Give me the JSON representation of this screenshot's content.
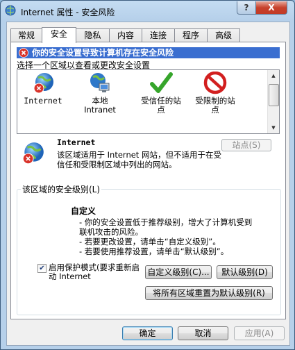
{
  "window": {
    "title": "Internet 属性 - 安全风险",
    "help_label": "?",
    "close_label": "X"
  },
  "tabs": [
    {
      "label": "常规"
    },
    {
      "label": "安全"
    },
    {
      "label": "隐私"
    },
    {
      "label": "内容"
    },
    {
      "label": "连接"
    },
    {
      "label": "程序"
    },
    {
      "label": "高级"
    }
  ],
  "warning": {
    "text": "你的安全设置导致计算机存在安全风险"
  },
  "zone_prompt": "选择一个区域以查看或更改安全设置",
  "zones": [
    {
      "label": "Internet",
      "icon": "globe-error-icon"
    },
    {
      "label": "本地\nIntranet",
      "icon": "intranet-icon"
    },
    {
      "label": "受信任的站\n点",
      "icon": "green-check-icon"
    },
    {
      "label": "受限制的站\n点",
      "icon": "restricted-icon"
    }
  ],
  "zone_info": {
    "title": "Internet",
    "description": "该区域适用于 Internet 网站，但不适用于在受信任和受限制区域中列出的网站。",
    "sites_button": "站点(S)"
  },
  "security_level": {
    "group_label": "该区域的安全级别(L)",
    "level_name": "自定义",
    "description": "- 你的安全设置低于推荐级别，增大了计算机受到联机攻击的风险。\n- 若要更改设置，请单击“自定义级别”。\n- 若要使用推荐设置，请单击“默认级别”。",
    "protected_mode_label": "启用保护模式(要求重新启动 Internet",
    "protected_mode_checked": true,
    "custom_level_button": "自定义级别(C)...",
    "default_level_button": "默认级别(D)",
    "reset_all_button": "将所有区域重置为默认级别(R)"
  },
  "footer": {
    "ok_button": "确定",
    "cancel_button": "取消",
    "apply_button": "应用(A)"
  },
  "colors": {
    "warning_bar": "#3a6ed0",
    "close_button": "#c7412c"
  }
}
